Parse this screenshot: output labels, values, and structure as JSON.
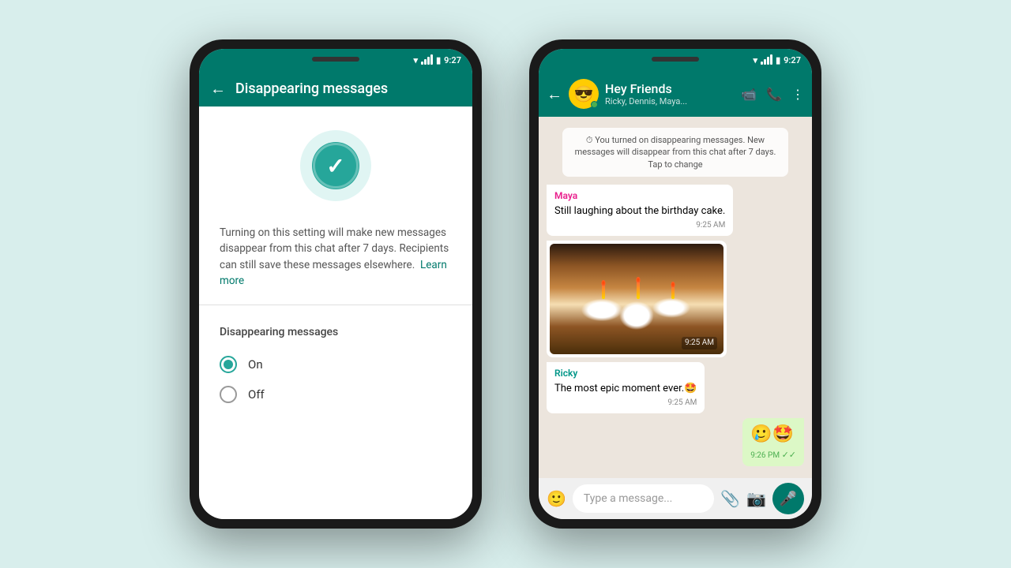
{
  "background_color": "#d8eeec",
  "phone1": {
    "status_bar": {
      "time": "9:27"
    },
    "header": {
      "title": "Disappearing messages",
      "back_label": "←"
    },
    "description": "Turning on this setting will make new messages disappear from this chat after 7 days. Recipients can still save these messages elsewhere.",
    "learn_more": "Learn more",
    "section_label": "Disappearing messages",
    "radio_on": {
      "label": "On",
      "selected": true
    },
    "radio_off": {
      "label": "Off",
      "selected": false
    }
  },
  "phone2": {
    "status_bar": {
      "time": "9:27"
    },
    "header": {
      "group_name": "Hey Friends",
      "group_members": "Ricky, Dennis, Maya...",
      "back_label": "←"
    },
    "system_message": "You turned on disappearing messages. New messages will disappear from this chat after 7 days. Tap to change",
    "messages": [
      {
        "id": "msg1",
        "sender": "Maya",
        "sender_color": "maya",
        "text": "Still laughing about the birthday cake.",
        "time": "9:25 AM",
        "type": "received"
      },
      {
        "id": "msg2",
        "sender": "",
        "text": "[cake image]",
        "time": "9:25 AM",
        "type": "image"
      },
      {
        "id": "msg3",
        "sender": "Ricky",
        "sender_color": "ricky",
        "text": "The most epic moment ever.🤩",
        "time": "9:25 AM",
        "type": "received"
      },
      {
        "id": "msg4",
        "sender": "",
        "text": "🥲🤩",
        "time": "9:26 PM",
        "type": "sent",
        "ticks": "✓✓"
      }
    ],
    "input_placeholder": "Type a message..."
  }
}
